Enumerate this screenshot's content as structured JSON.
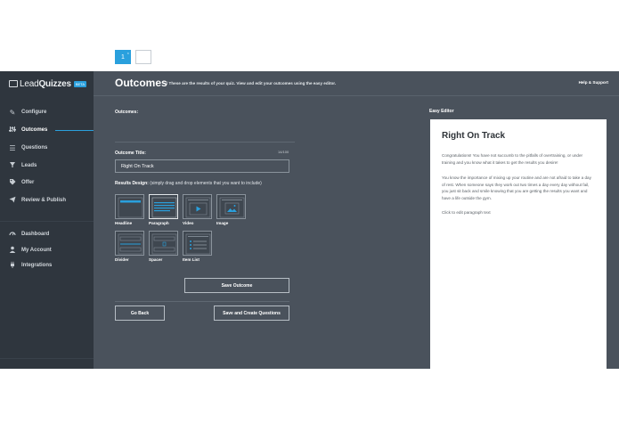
{
  "brand": {
    "name_light": "Lead",
    "name_bold": "Quizzes",
    "badge": "BETA"
  },
  "sidebar": {
    "items": [
      {
        "label": "Configure",
        "icon": "pencil-icon"
      },
      {
        "label": "Outcomes",
        "icon": "sliders-icon"
      },
      {
        "label": "Questions",
        "icon": "list-icon"
      },
      {
        "label": "Leads",
        "icon": "funnel-icon"
      },
      {
        "label": "Offer",
        "icon": "tag-icon"
      },
      {
        "label": "Review & Publish",
        "icon": "plane-icon"
      },
      {
        "label": "Dashboard",
        "icon": "gauge-icon"
      },
      {
        "label": "My Account",
        "icon": "user-icon"
      },
      {
        "label": "Integrations",
        "icon": "plug-icon"
      }
    ],
    "active": "Outcomes"
  },
  "header": {
    "title": "Outcomes",
    "subtitle": "/  These are the results of your quiz. View and edit your outcomes using the easy editor.",
    "help": "Help & Support"
  },
  "form": {
    "outcomes_label": "Outcomes:",
    "tabs": [
      "1"
    ],
    "tab_close": "×",
    "add_label": "+",
    "outcome_title_label": "Outcome Title:",
    "char_count": "14/100",
    "outcome_title_value": "Right On Track",
    "results_design_label": "Results Design:",
    "results_design_hint": "(simply drag and drop elements that you want to include)",
    "elements": [
      "Headline",
      "Paragraph",
      "Video",
      "Image",
      "Divider",
      "Spacer",
      "Item List"
    ],
    "selected_element": "Paragraph",
    "save_outcome": "Save Outcome",
    "go_back": "Go Back",
    "save_and_create": "Save and Create Questions"
  },
  "editor": {
    "label": "Easy Editor",
    "heading": "Right On Track",
    "paragraphs": [
      "Congratulations! You have not succumb to the pitfalls of overtraining, or under training and you know what it takes to get the results you desire!",
      "You know the importance of mixing up your routine and are not afraid to take a day of rest. When someone says they work out two times a day every day without fail, you just sit back and smile knowing that you are getting the results you want and have a life outside the gym."
    ],
    "hint": "Click to edit paragraph text"
  },
  "colors": {
    "accent": "#2aa0dd",
    "sidebar": "#2f363e",
    "main": "#4a525c"
  }
}
